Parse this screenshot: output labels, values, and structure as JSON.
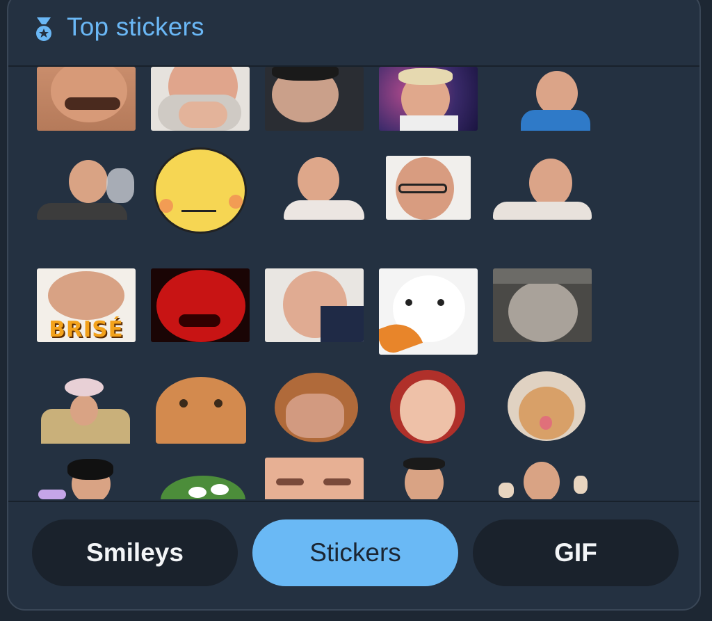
{
  "header": {
    "title": "Top stickers",
    "icon": "medal-icon",
    "accent": "#6ab7f5"
  },
  "stickers": [
    {
      "id": "s1",
      "desc": "face closeup"
    },
    {
      "id": "s2",
      "desc": "bearded man"
    },
    {
      "id": "s3",
      "desc": "man lying"
    },
    {
      "id": "s4",
      "desc": "man space background"
    },
    {
      "id": "s5",
      "desc": "man blue jacket"
    },
    {
      "id": "s6",
      "desc": "man monocle"
    },
    {
      "id": "s7",
      "desc": "yellow smiley"
    },
    {
      "id": "s8",
      "desc": "long hair man"
    },
    {
      "id": "s9",
      "desc": "man glasses"
    },
    {
      "id": "s10",
      "desc": "man laughing"
    },
    {
      "id": "s11",
      "desc": "broken face",
      "caption": "BRISÉ"
    },
    {
      "id": "s12",
      "desc": "red face"
    },
    {
      "id": "s13",
      "desc": "old man glasses laughing"
    },
    {
      "id": "s14",
      "desc": "cat eating pizza"
    },
    {
      "id": "s15",
      "desc": "grey cat"
    },
    {
      "id": "s16",
      "desc": "man with flowers"
    },
    {
      "id": "s17",
      "desc": "orange cat"
    },
    {
      "id": "s18",
      "desc": "bear costume man"
    },
    {
      "id": "s19",
      "desc": "red hair woman"
    },
    {
      "id": "s20",
      "desc": "cat in bear hat"
    },
    {
      "id": "s21",
      "desc": "man black hair"
    },
    {
      "id": "s22",
      "desc": "green frog"
    },
    {
      "id": "s23",
      "desc": "face closeup"
    },
    {
      "id": "s24",
      "desc": "man shaved head"
    },
    {
      "id": "s25",
      "desc": "man pointing"
    }
  ],
  "tabs": [
    {
      "label": "Smileys",
      "active": false
    },
    {
      "label": "Stickers",
      "active": true
    },
    {
      "label": "GIF",
      "active": false
    }
  ]
}
